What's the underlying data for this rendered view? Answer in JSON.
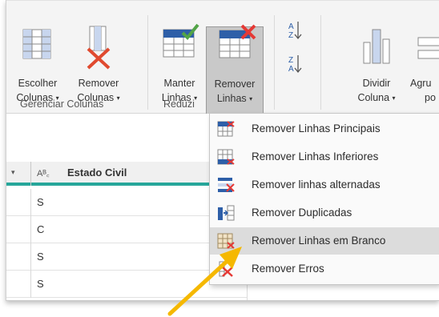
{
  "ribbon": {
    "buttons": {
      "choose_columns": {
        "line1": "Escolher",
        "line2": "Colunas",
        "icon": "choose-columns-icon"
      },
      "remove_columns": {
        "line1": "Remover",
        "line2": "Colunas",
        "icon": "remove-columns-icon"
      },
      "keep_rows": {
        "line1": "Manter",
        "line2": "Linhas",
        "icon": "keep-rows-icon"
      },
      "remove_rows": {
        "line1": "Remover",
        "line2": "Linhas",
        "icon": "remove-rows-icon"
      },
      "sort_asc": {
        "icon": "sort-ascending-icon"
      },
      "sort_desc": {
        "icon": "sort-descending-icon"
      },
      "split_column": {
        "line1": "Dividir",
        "line2": "Coluna",
        "icon": "split-column-icon"
      },
      "group_by": {
        "line1": "Agru",
        "line2": "po",
        "icon": "group-by-icon"
      }
    },
    "groups": {
      "manage_columns": "Gerenciar Colunas",
      "reduce_rows": "Reduzi"
    },
    "caret": "▾"
  },
  "grid": {
    "header": {
      "arrow": "▾",
      "type_label": "Aᴮ꜀",
      "column_title": "Estado Civil"
    },
    "rows": [
      "S",
      "C",
      "S",
      "S"
    ]
  },
  "menu": {
    "items": [
      {
        "label": "Remover Linhas Principais",
        "icon": "remove-top-rows-icon"
      },
      {
        "label": "Remover Linhas Inferiores",
        "icon": "remove-bottom-rows-icon"
      },
      {
        "label": "Remover linhas alternadas",
        "icon": "remove-alternate-rows-icon"
      },
      {
        "label": "Remover Duplicadas",
        "icon": "remove-duplicates-icon"
      },
      {
        "label": "Remover Linhas em Branco",
        "icon": "remove-blank-rows-icon",
        "highlighted": true
      },
      {
        "label": "Remover Erros",
        "icon": "remove-errors-icon"
      }
    ]
  },
  "colors": {
    "accent_teal": "#26a69a",
    "annotation_arrow": "#f5b800",
    "remove_red": "#e53935",
    "icon_blue": "#2e5fa8"
  }
}
